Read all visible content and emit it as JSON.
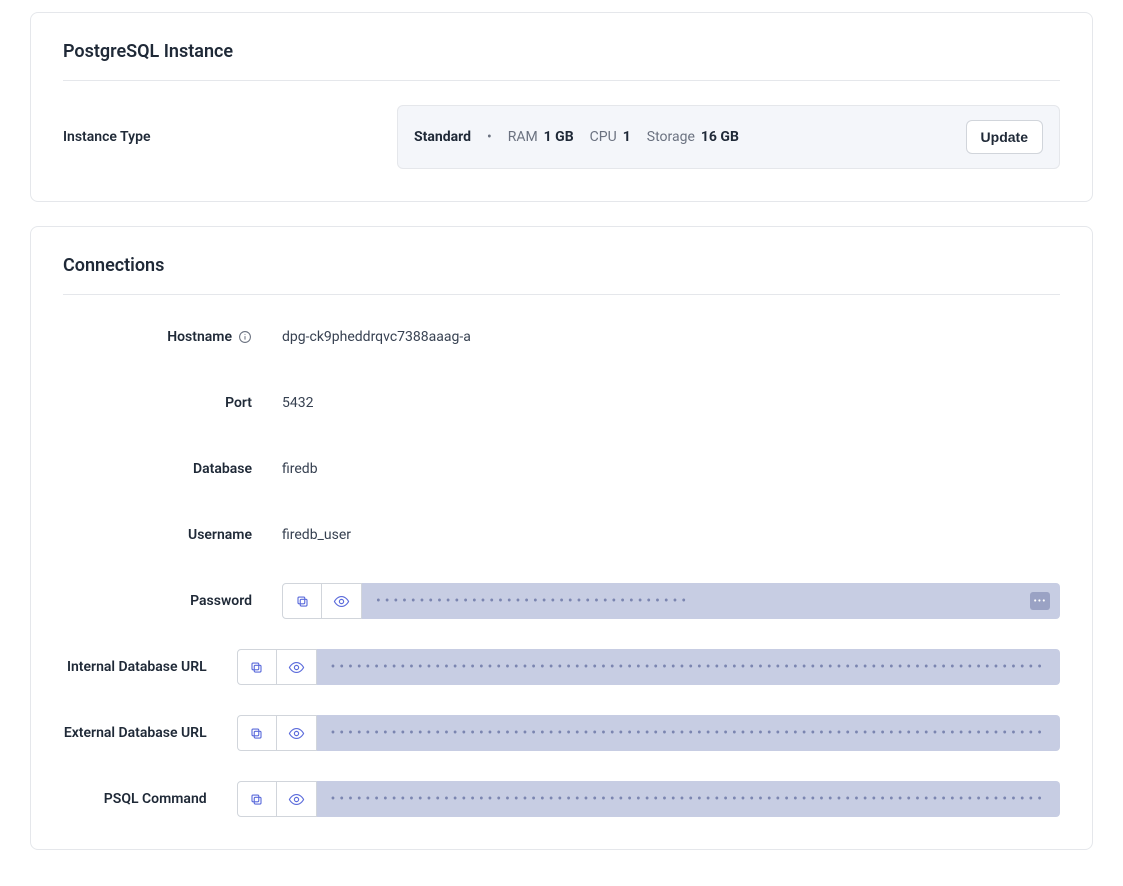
{
  "instance_card": {
    "title": "PostgreSQL Instance",
    "type_label": "Instance Type",
    "plan": "Standard",
    "ram_label": "RAM",
    "ram_value": "1 GB",
    "cpu_label": "CPU",
    "cpu_value": "1",
    "storage_label": "Storage",
    "storage_value": "16 GB",
    "update_button": "Update"
  },
  "connections_card": {
    "title": "Connections",
    "rows": {
      "hostname": {
        "label": "Hostname",
        "value": "dpg-ck9pheddrqvc7388aaag-a",
        "has_info": true
      },
      "port": {
        "label": "Port",
        "value": "5432"
      },
      "database": {
        "label": "Database",
        "value": "firedb"
      },
      "username": {
        "label": "Username",
        "value": "firedb_user"
      },
      "password": {
        "label": "Password",
        "masked": true,
        "mask_len": 36,
        "show_ellipsis": true
      },
      "internal_url": {
        "label": "Internal Database URL",
        "masked": true,
        "mask_len": 82
      },
      "external_url": {
        "label": "External Database URL",
        "masked": true,
        "mask_len": 82
      },
      "psql": {
        "label": "PSQL Command",
        "masked": true,
        "mask_len": 82
      }
    }
  },
  "icons": {
    "copy": "copy-icon",
    "eye": "eye-icon",
    "info": "info-icon"
  }
}
